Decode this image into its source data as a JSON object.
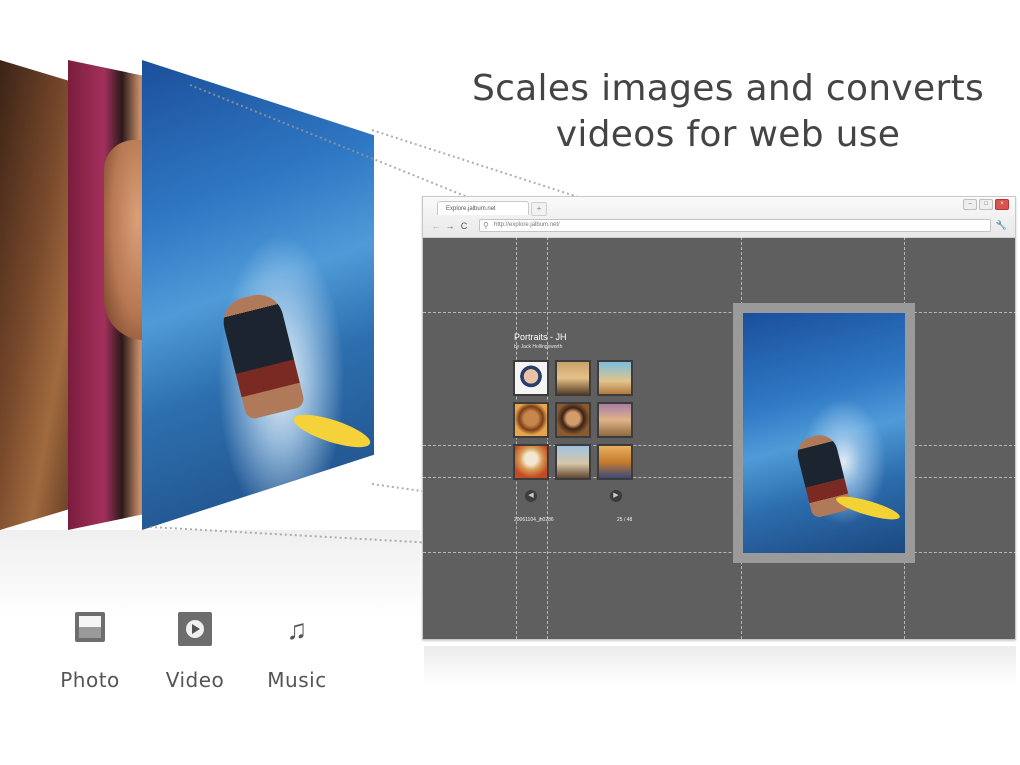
{
  "headline": {
    "line1": "Scales images and converts",
    "line2": "videos for web use"
  },
  "browser": {
    "tab_label": "Explore.jalbum.net",
    "new_tab_label": "+",
    "window_controls": [
      "minimize-icon",
      "maximize-icon",
      "close-icon"
    ],
    "url": "http://explore.jalbum.net/",
    "nav": {
      "back": "←",
      "forward": "→",
      "reload": "C"
    },
    "wrench_icon": "wrench-icon"
  },
  "album": {
    "title": "Portraits - JH",
    "author": "by Jack Hollingsworth",
    "prev_label": "◀",
    "next_label": "▶",
    "filename": "20061104_jh0286",
    "counter": "25 / 48"
  },
  "media_types": [
    {
      "label": "Photo",
      "icon": "photo-icon"
    },
    {
      "label": "Video",
      "icon": "video-icon"
    },
    {
      "label": "Music",
      "icon": "music-note-icon"
    }
  ],
  "colors": {
    "headline_text": "#444444",
    "browser_background": "#5f5f5f",
    "label_text": "#555555"
  }
}
